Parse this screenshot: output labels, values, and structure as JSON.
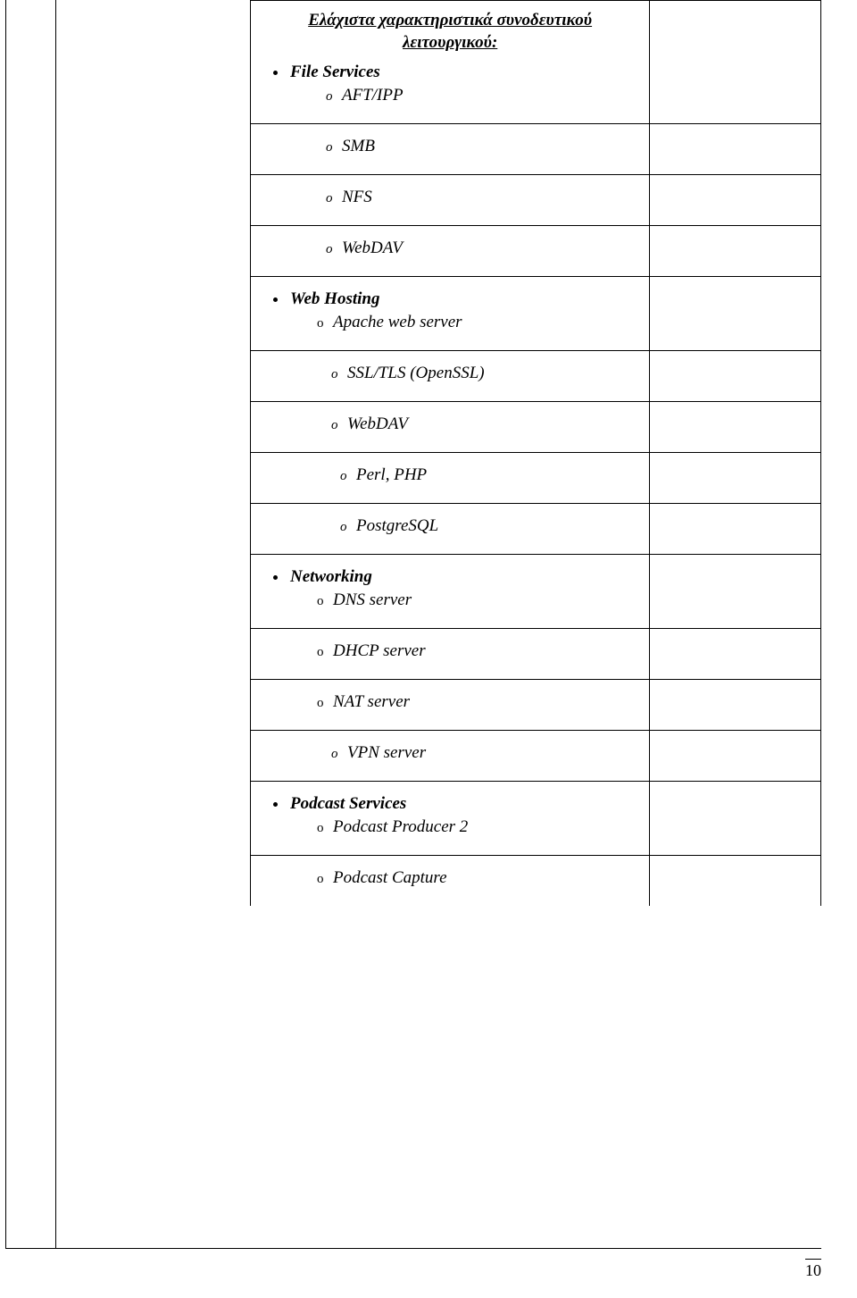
{
  "page_number": "10",
  "title_line1": "Ελάχιστα χαρακτηριστικά συνοδευτικού",
  "title_line2": "λειτουργικού:",
  "sections": {
    "file_services": {
      "header": "File Services",
      "items": {
        "aft": "AFT/IPP",
        "smb": "SMB",
        "nfs": "NFS",
        "webdav": "WebDAV"
      }
    },
    "web_hosting": {
      "header": "Web Hosting",
      "items": {
        "apache": "Apache web server",
        "ssl": "SSL/TLS (OpenSSL)",
        "webdav2": "WebDAV",
        "perl": "Perl, PHP",
        "postgres": "PostgreSQL"
      }
    },
    "networking": {
      "header": "Networking",
      "items": {
        "dns": "DNS server",
        "dhcp": "DHCP server",
        "nat": "NAT server",
        "vpn": "VPN server"
      }
    },
    "podcast": {
      "header": "Podcast Services",
      "items": {
        "producer": "Podcast Producer 2",
        "capture": "Podcast Capture"
      }
    }
  }
}
